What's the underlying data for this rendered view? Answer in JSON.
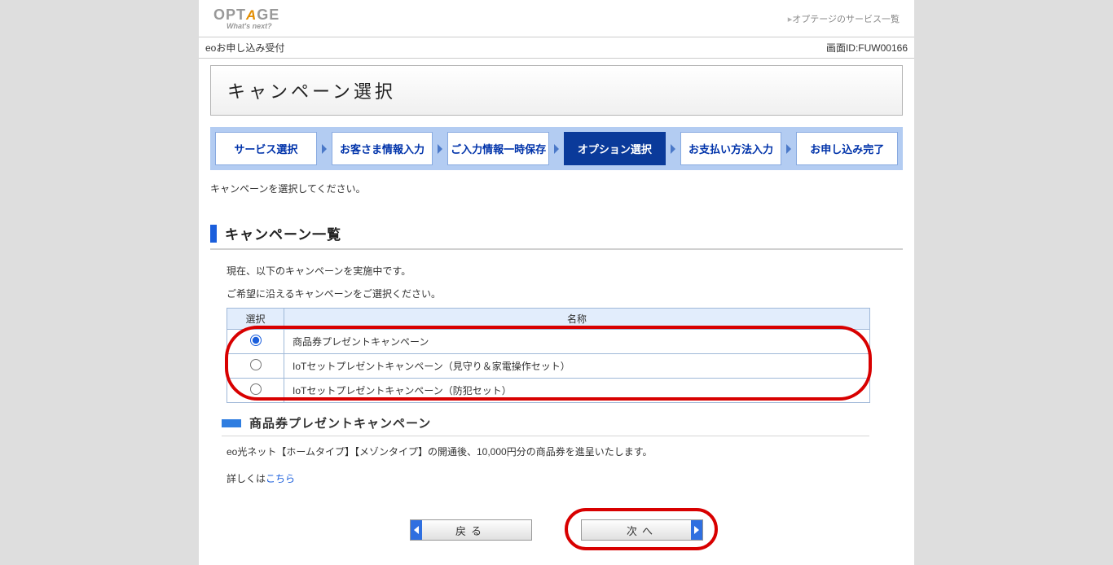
{
  "header": {
    "logo_main_pre": "OPT",
    "logo_main_post": "GE",
    "logo_sub": "What's next?",
    "service_link": "オプテージのサービス一覧"
  },
  "breadcrumb": {
    "path": "eoお申し込み受付",
    "screen_id": "画面ID:FUW00166"
  },
  "page_title": "キャンペーン選択",
  "steps": [
    {
      "label": "サービス選択",
      "active": false
    },
    {
      "label": "お客さま情報入力",
      "active": false
    },
    {
      "label": "ご入力情報一時保存",
      "active": false
    },
    {
      "label": "オプション選択",
      "active": true
    },
    {
      "label": "お支払い方法入力",
      "active": false
    },
    {
      "label": "お申し込み完了",
      "active": false
    }
  ],
  "note": "キャンペーンを選択してください。",
  "section_heading": "キャンペーン一覧",
  "subnote_1": "現在、以下のキャンペーンを実施中です。",
  "subnote_2": "ご希望に沿えるキャンペーンをご選択ください。",
  "table": {
    "col_select": "選択",
    "col_name": "名称",
    "rows": [
      {
        "name": "商品券プレゼントキャンペーン",
        "checked": true
      },
      {
        "name": "IoTセットプレゼントキャンペーン（見守り＆家電操作セット）",
        "checked": false
      },
      {
        "name": "IoTセットプレゼントキャンペーン（防犯セット）",
        "checked": false
      }
    ]
  },
  "sub_heading": "商品券プレゼントキャンペーン",
  "prize_note": "eo光ネット【ホームタイプ】【メゾンタイプ】の開通後、10,000円分の商品券を進呈いたします。",
  "detail_prefix": "詳しくは",
  "detail_link": "こちら",
  "buttons": {
    "back": "戻る",
    "next": "次へ"
  }
}
